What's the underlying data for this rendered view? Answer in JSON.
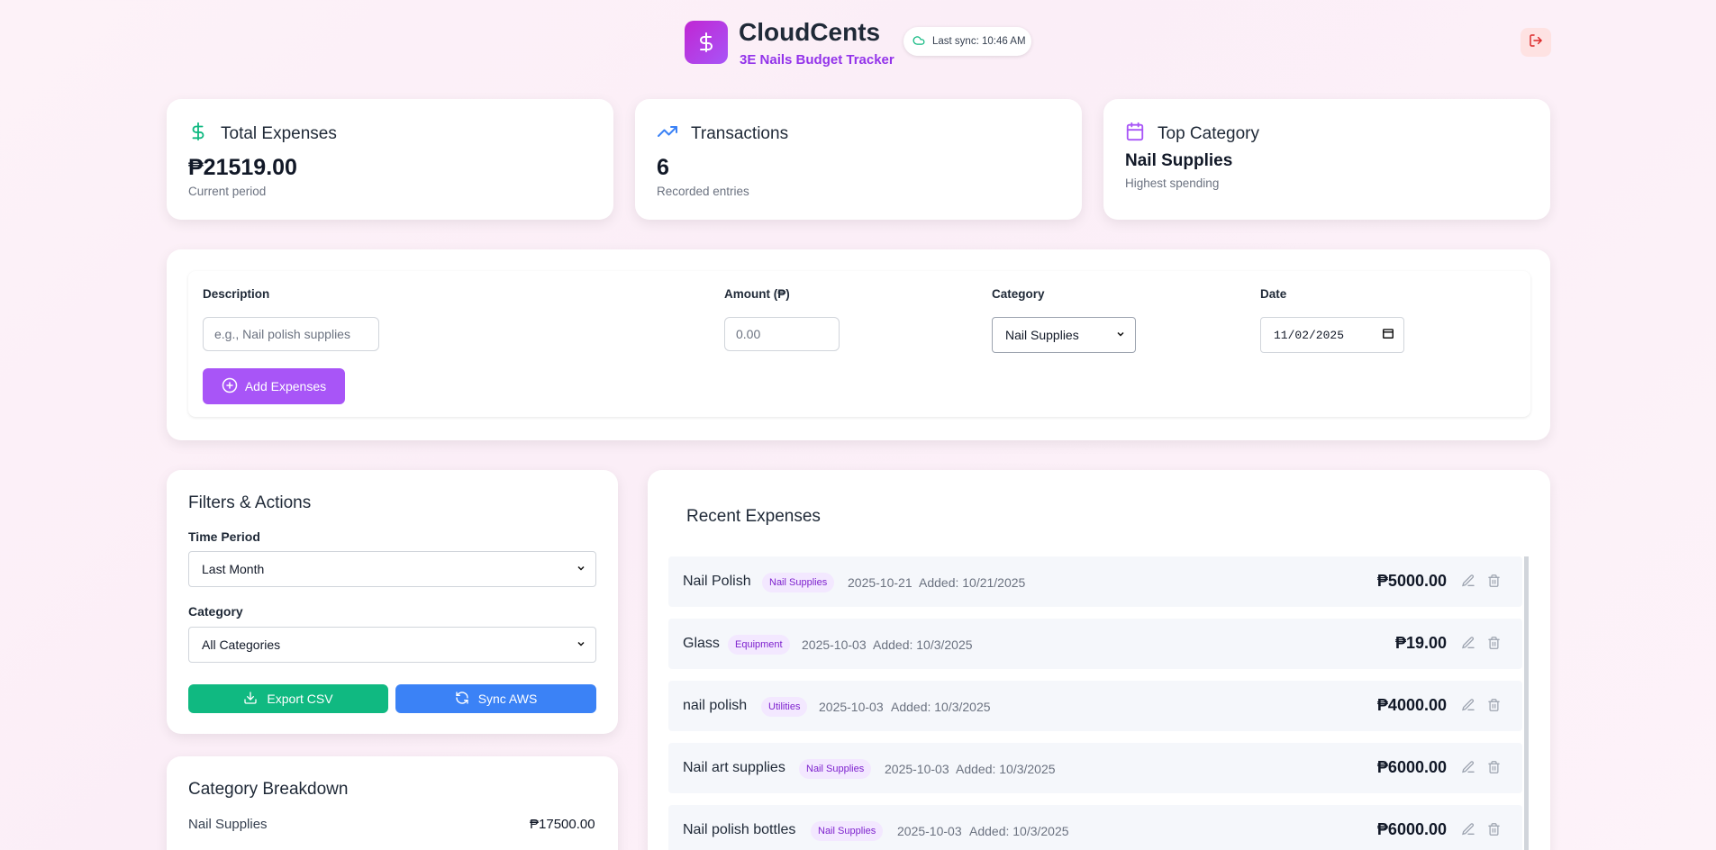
{
  "header": {
    "title": "CloudCents",
    "subtitle": "3E Nails Budget Tracker",
    "sync_text": "Last sync: 10:46 AM"
  },
  "stats": {
    "total": {
      "label": "Total Expenses",
      "value": "₱21519.00",
      "note": "Current period"
    },
    "transactions": {
      "label": "Transactions",
      "value": "6",
      "note": "Recorded entries"
    },
    "top_category": {
      "label": "Top Category",
      "value": "Nail Supplies",
      "note": "Highest spending"
    }
  },
  "form": {
    "description_label": "Description",
    "description_placeholder": "e.g., Nail polish supplies",
    "amount_label": "Amount (₱)",
    "amount_placeholder": "0.00",
    "category_label": "Category",
    "category_value": "Nail Supplies",
    "date_label": "Date",
    "date_value": "11/02/2025",
    "add_button": "Add Expenses"
  },
  "filters": {
    "title": "Filters & Actions",
    "period_label": "Time Period",
    "period_value": "Last Month",
    "category_label": "Category",
    "category_value": "All Categories",
    "export_button": "Export CSV",
    "sync_button": "Sync AWS"
  },
  "breakdown": {
    "title": "Category Breakdown",
    "items": [
      {
        "name": "Nail Supplies",
        "amount": "₱17500.00"
      }
    ]
  },
  "recent": {
    "title": "Recent Expenses",
    "items": [
      {
        "name": "Nail Polish",
        "category": "Nail Supplies",
        "date": "2025-10-21",
        "added": "Added: 10/21/2025",
        "amount": "₱5000.00"
      },
      {
        "name": "Glass",
        "category": "Equipment",
        "date": "2025-10-03",
        "added": "Added: 10/3/2025",
        "amount": "₱19.00"
      },
      {
        "name": "nail polish",
        "category": "Utilities",
        "date": "2025-10-03",
        "added": "Added: 10/3/2025",
        "amount": "₱4000.00"
      },
      {
        "name": "Nail art supplies",
        "category": "Nail Supplies",
        "date": "2025-10-03",
        "added": "Added: 10/3/2025",
        "amount": "₱6000.00"
      },
      {
        "name": "Nail polish bottles",
        "category": "Nail Supplies",
        "date": "2025-10-03",
        "added": "Added: 10/3/2025",
        "amount": "₱6000.00"
      }
    ]
  },
  "colors": {
    "accent": "#a855f7",
    "export_green": "#10b981",
    "sync_blue": "#3b82f6"
  }
}
